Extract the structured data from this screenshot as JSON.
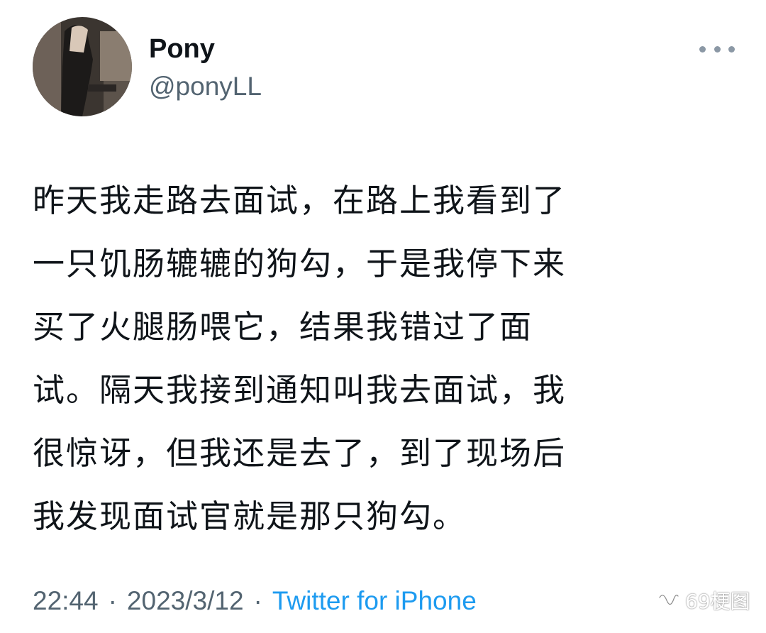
{
  "author": {
    "display_name": "Pony",
    "handle": "@ponyLL"
  },
  "tweet": {
    "lines": [
      "昨天我走路去面试，在路上我看到了",
      "一只饥肠辘辘的狗勾，于是我停下来",
      "买了火腿肠喂它，结果我错过了面",
      "试。隔天我接到通知叫我去面试，我",
      "很惊讶，但我还是去了，到了现场后",
      "我发现面试官就是那只狗勾。"
    ]
  },
  "meta": {
    "time": "22:44",
    "separator": "·",
    "date": "2023/3/12",
    "source": "Twitter for iPhone"
  },
  "watermark": {
    "text": "69梗图",
    "icon": "wechat-channel-icon"
  },
  "icons": {
    "more": "more-dots-icon"
  },
  "colors": {
    "text_primary": "#0f1419",
    "text_secondary": "#536471",
    "link": "#1d9bf0"
  }
}
